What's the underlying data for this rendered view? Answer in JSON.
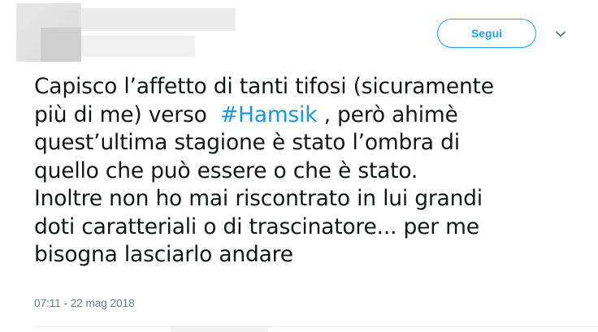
{
  "header": {
    "follow_label": "Segui"
  },
  "tweet": {
    "line1": "Capisco l’affetto di tanti tifosi (sicuramente",
    "line2_before": "più di me) verso  ",
    "hashtag": "#Hamsik",
    "line2_after": " , però ahimè",
    "line3": "quest’ultima stagione è stato l’ombra di",
    "line4": "quello che può essere o che è stato.",
    "line5": "Inoltre non ho mai riscontrato in lui grandi",
    "line6": "doti caratteriali o di trascinatore... per me",
    "line7": "bisogna lasciarlo andare",
    "timestamp": "07:11 - 22 mag 2018"
  },
  "colors": {
    "accent": "#1da1f2",
    "hashtag": "#1b95e0",
    "text": "#14171a",
    "muted": "#657786"
  },
  "icons": {
    "menu": "chevron-down-icon"
  }
}
